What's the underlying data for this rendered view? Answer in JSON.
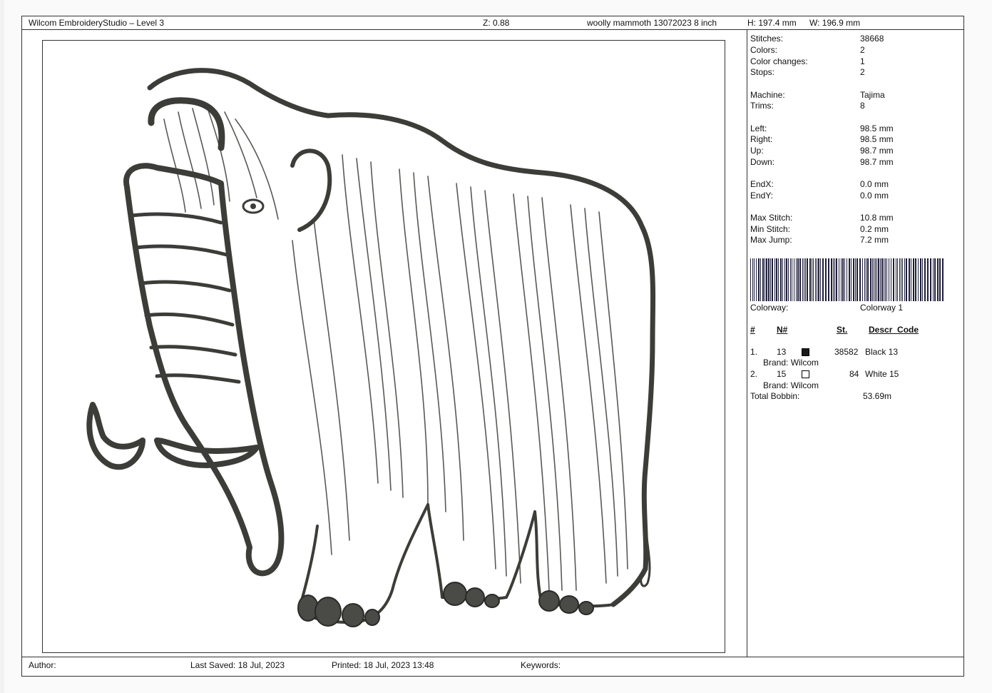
{
  "header": {
    "app_title": "Wilcom EmbroideryStudio – Level 3",
    "zoom": "Z: 0.88",
    "design_name": "woolly mammoth 13072023  8 inch",
    "height": "H: 197.4 mm",
    "width": "W: 196.9 mm"
  },
  "stats": [
    {
      "label": "Stitches:",
      "value": "38668"
    },
    {
      "label": "Colors:",
      "value": "2"
    },
    {
      "label": "Color changes:",
      "value": "1"
    },
    {
      "label": "Stops:",
      "value": "2"
    },
    {
      "label": "Machine:",
      "value": "Tajima"
    },
    {
      "label": "Trims:",
      "value": "8"
    },
    {
      "label": "Left:",
      "value": "98.5 mm"
    },
    {
      "label": "Right:",
      "value": "98.5 mm"
    },
    {
      "label": "Up:",
      "value": "98.7 mm"
    },
    {
      "label": "Down:",
      "value": "98.7 mm"
    },
    {
      "label": "EndX:",
      "value": "0.0 mm"
    },
    {
      "label": "EndY:",
      "value": "0.0 mm"
    },
    {
      "label": "Max Stitch:",
      "value": "10.8 mm"
    },
    {
      "label": "Min Stitch:",
      "value": "0.2 mm"
    },
    {
      "label": "Max Jump:",
      "value": "7.2 mm"
    }
  ],
  "colorway": {
    "label": "Colorway:",
    "value": "Colorway 1"
  },
  "color_table": {
    "headers": {
      "index": "#",
      "number": "N#",
      "stitches": "St.",
      "description": "Descr_Code"
    },
    "rows": [
      {
        "index": "1.",
        "number": "13",
        "color": "#1a1a1a",
        "stitches": "38582",
        "description": "Black 13",
        "brand": "Brand: Wilcom"
      },
      {
        "index": "2.",
        "number": "15",
        "color": "#ffffff",
        "stitches": "84",
        "description": "White 15",
        "brand": "Brand: Wilcom"
      }
    ]
  },
  "total_bobbin": {
    "label": "Total Bobbin:",
    "value": "53.69m"
  },
  "footer": {
    "author": "Author:",
    "last_saved": "Last Saved: 18 Jul, 2023",
    "printed": "Printed: 18 Jul, 2023 13:48",
    "keywords": "Keywords:"
  },
  "colors": {
    "thread_dark": "#3c3c38",
    "border": "#333333"
  }
}
